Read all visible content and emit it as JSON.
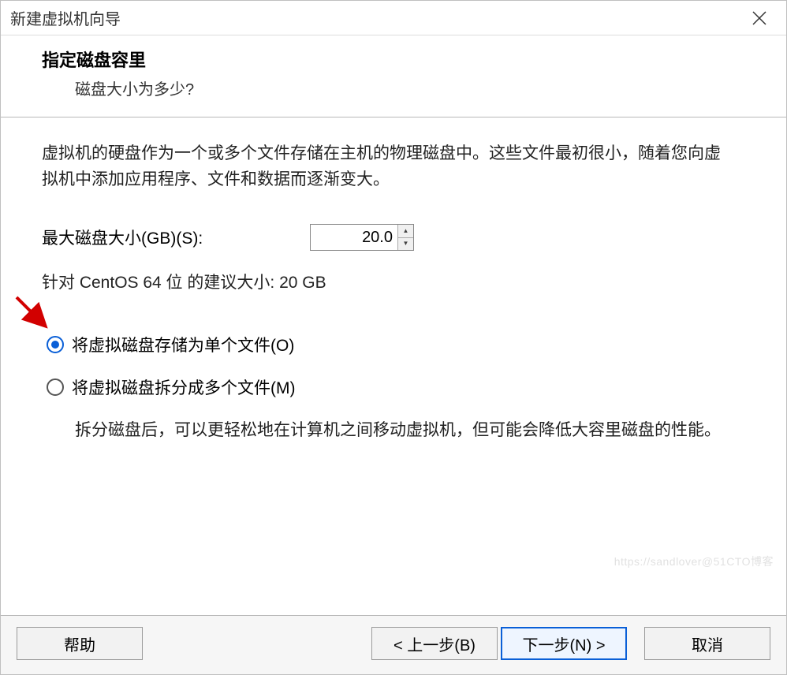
{
  "window": {
    "title": "新建虚拟机向导"
  },
  "header": {
    "title": "指定磁盘容里",
    "subtitle": "磁盘大小为多少?"
  },
  "content": {
    "description": "虚拟机的硬盘作为一个或多个文件存储在主机的物理磁盘中。这些文件最初很小，随着您向虚拟机中添加应用程序、文件和数据而逐渐变大。",
    "size_label": "最大磁盘大小(GB)(S):",
    "size_value": "20.0",
    "recommend": "针对 CentOS 64 位 的建议大小: 20 GB",
    "radio_single": "将虚拟磁盘存储为单个文件(O)",
    "radio_split": "将虚拟磁盘拆分成多个文件(M)",
    "split_desc": "拆分磁盘后，可以更轻松地在计算机之间移动虚拟机，但可能会降低大容里磁盘的性能。"
  },
  "footer": {
    "help": "帮助",
    "back": "< 上一步(B)",
    "next": "下一步(N) >",
    "cancel": "取消"
  },
  "watermark": "https://sandlover@51CTO博客"
}
